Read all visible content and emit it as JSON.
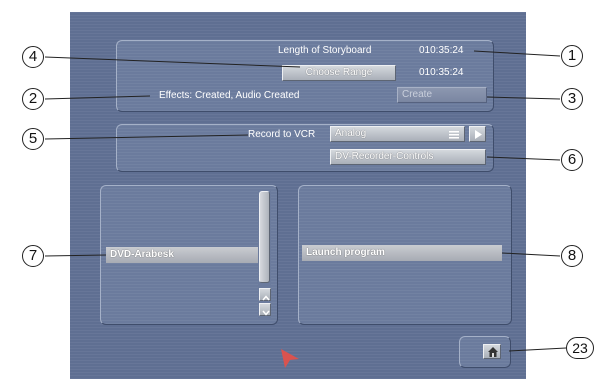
{
  "storyboard": {
    "length_label": "Length of Storyboard",
    "length_value": "010:35:24",
    "range_button": "Choose Range",
    "range_value": "010:35:24",
    "effects_status": "Effects: Created, Audio Created",
    "create_button": "Create"
  },
  "record": {
    "label": "Record to VCR",
    "select_value": "Analog",
    "recorder_controls_button": "DV-Recorder-Controls"
  },
  "left_list": {
    "selected_item": "DVD-Arabesk"
  },
  "right_list": {
    "selected_item": "Launch program"
  },
  "callouts": [
    "1",
    "2",
    "3",
    "4",
    "5",
    "6",
    "7",
    "8",
    "23"
  ],
  "icons": {
    "menu": "menu-lines-icon",
    "play": "play-arrow-icon",
    "scroll_up": "chevron-up-icon",
    "scroll_down": "chevron-down-icon",
    "home": "home-icon",
    "cursor": "pointer-cursor-icon"
  },
  "colors": {
    "background": "#5f6f92",
    "button": "#c4c8ce",
    "cursor": "#d9534f"
  }
}
